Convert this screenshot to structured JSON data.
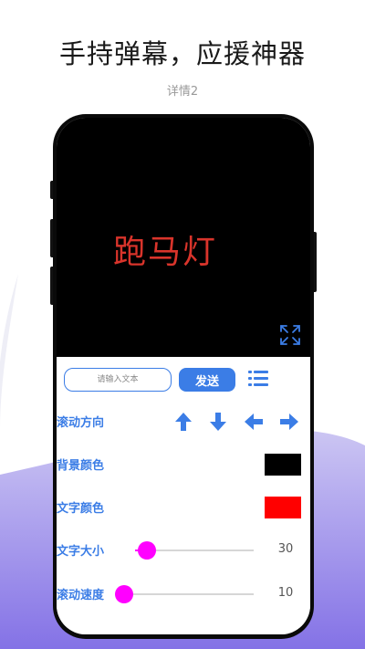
{
  "promo": {
    "headline": "手持弹幕，应援神器",
    "subhead": "详情2"
  },
  "display": {
    "text": "跑马灯",
    "text_color": "#d9342b",
    "background_color": "#000000",
    "fullscreen_icon": "fullscreen-expand-icon"
  },
  "controls": {
    "input_placeholder": "请输入文本",
    "send_label": "发送",
    "list_icon": "list-icon",
    "direction": {
      "label": "滚动方向",
      "arrows": [
        "arrow-up-icon",
        "arrow-down-icon",
        "arrow-left-icon",
        "arrow-right-icon"
      ]
    },
    "background_color": {
      "label": "背景颜色",
      "value": "#000000"
    },
    "text_color": {
      "label": "文字颜色",
      "value": "#ff0000"
    },
    "text_size": {
      "label": "文字大小",
      "value": "30",
      "fraction": 0.1
    },
    "scroll_speed": {
      "label": "滚动速度",
      "value": "10",
      "fraction": 0.0
    },
    "accent_color": "#3b7de6",
    "slider_color": "#ff00ff"
  }
}
